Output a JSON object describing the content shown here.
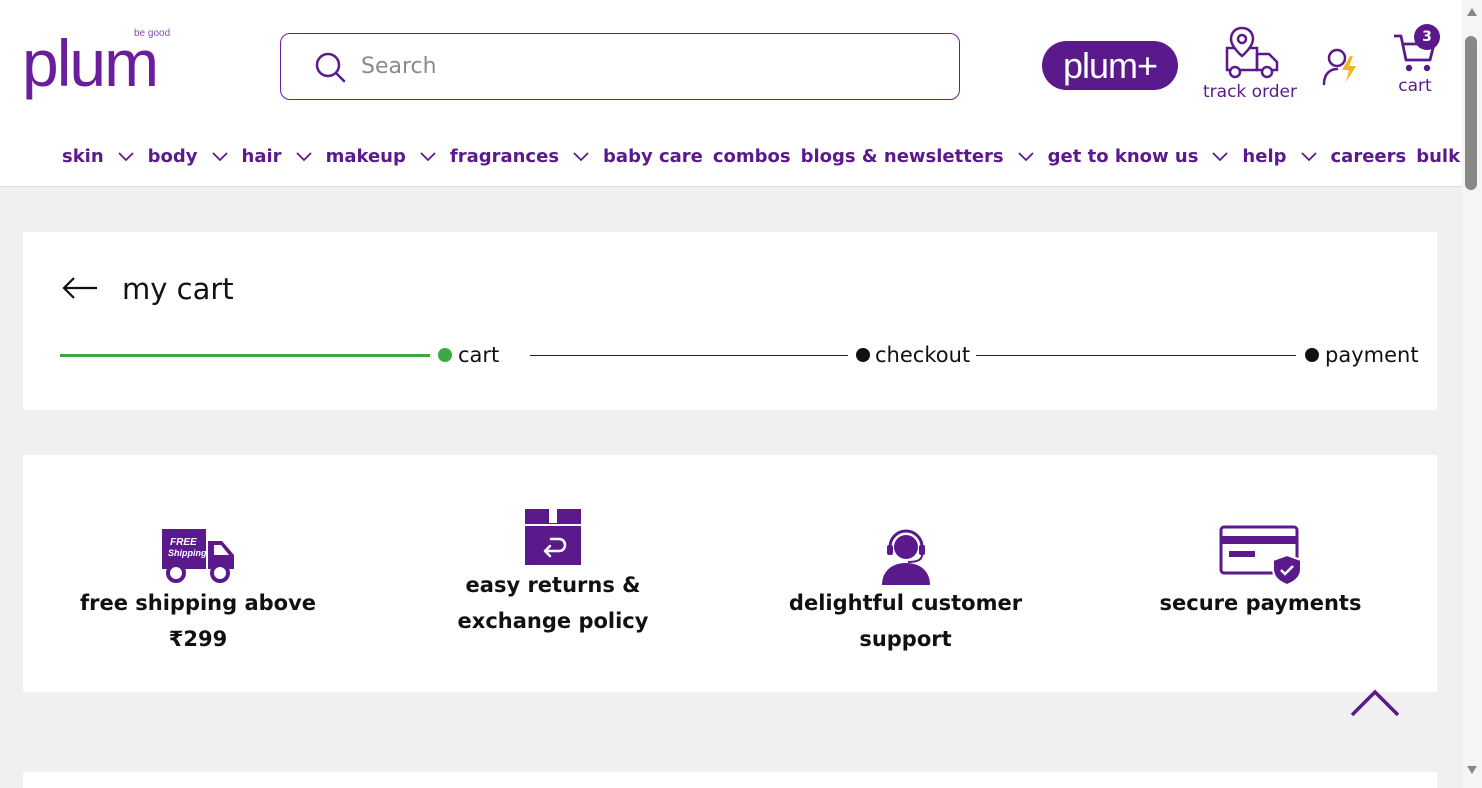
{
  "brand": {
    "name": "plum",
    "tagline": "be good",
    "plus_label": "plum+"
  },
  "search": {
    "placeholder": "Search"
  },
  "header_actions": {
    "track_order": "track order",
    "cart_label": "cart",
    "cart_count": "3"
  },
  "nav": [
    {
      "label": "skin",
      "has_dropdown": true
    },
    {
      "label": "body",
      "has_dropdown": true
    },
    {
      "label": "hair",
      "has_dropdown": true
    },
    {
      "label": "makeup",
      "has_dropdown": true
    },
    {
      "label": "fragrances",
      "has_dropdown": true
    },
    {
      "label": "baby care",
      "has_dropdown": false
    },
    {
      "label": "combos",
      "has_dropdown": false
    },
    {
      "label": "blogs & newsletters",
      "has_dropdown": true
    },
    {
      "label": "get to know us",
      "has_dropdown": true
    },
    {
      "label": "help",
      "has_dropdown": true
    },
    {
      "label": "careers",
      "has_dropdown": false
    },
    {
      "label": "bulk orders",
      "has_dropdown": false
    }
  ],
  "cart_page": {
    "title": "my cart",
    "steps": [
      {
        "label": "cart",
        "state": "active"
      },
      {
        "label": "checkout",
        "state": "pending"
      },
      {
        "label": "payment",
        "state": "pending"
      }
    ]
  },
  "benefits": [
    {
      "icon": "free-shipping-truck-icon",
      "label": "free shipping above ₹299",
      "badge": "FREE Shipping"
    },
    {
      "icon": "return-box-icon",
      "label": "easy returns & exchange policy"
    },
    {
      "icon": "customer-support-icon",
      "label": "delightful customer support"
    },
    {
      "icon": "secure-card-icon",
      "label": "secure payments"
    }
  ],
  "colors": {
    "brand": "#5b1a8c",
    "progress_done": "#3aa845",
    "page_bg": "#f0f0f0"
  }
}
